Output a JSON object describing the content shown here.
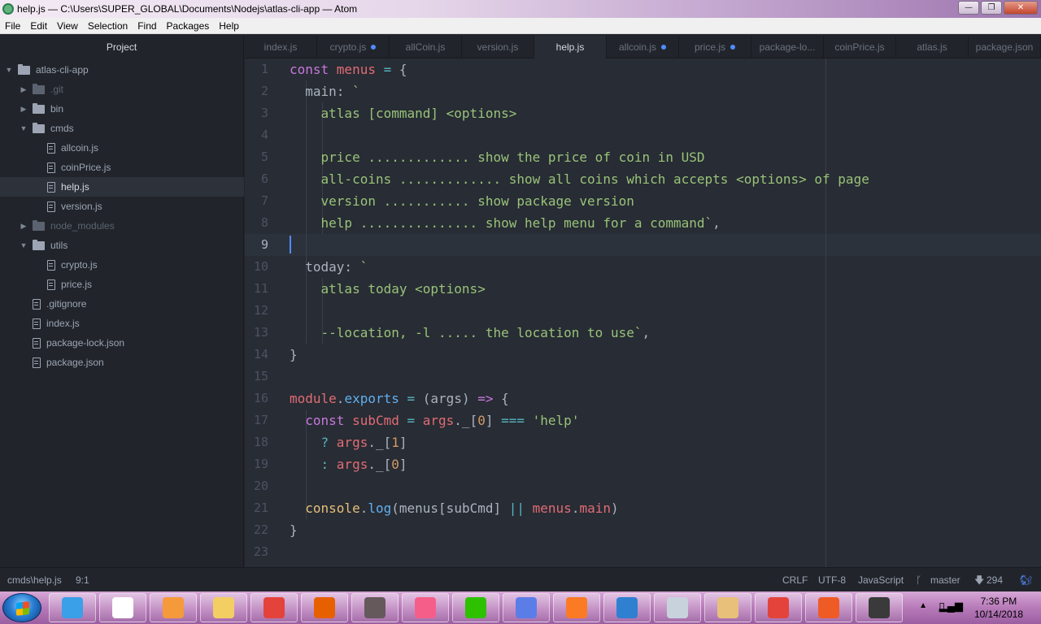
{
  "window": {
    "title": "help.js — C:\\Users\\SUPER_GLOBAL\\Documents\\Nodejs\\atlas-cli-app — Atom"
  },
  "menu": [
    "File",
    "Edit",
    "View",
    "Selection",
    "Find",
    "Packages",
    "Help"
  ],
  "sidebar": {
    "title": "Project",
    "tree": [
      {
        "label": "atlas-cli-app",
        "kind": "folder",
        "level": 0,
        "expanded": true
      },
      {
        "label": ".git",
        "kind": "folder",
        "level": 1,
        "expanded": false,
        "dim": true
      },
      {
        "label": "bin",
        "kind": "folder",
        "level": 1,
        "expanded": false
      },
      {
        "label": "cmds",
        "kind": "folder",
        "level": 1,
        "expanded": true
      },
      {
        "label": "allcoin.js",
        "kind": "file",
        "level": 2
      },
      {
        "label": "coinPrice.js",
        "kind": "file",
        "level": 2
      },
      {
        "label": "help.js",
        "kind": "file",
        "level": 2,
        "selected": true
      },
      {
        "label": "version.js",
        "kind": "file",
        "level": 2
      },
      {
        "label": "node_modules",
        "kind": "folder",
        "level": 1,
        "expanded": false,
        "dim": true
      },
      {
        "label": "utils",
        "kind": "folder",
        "level": 1,
        "expanded": true
      },
      {
        "label": "crypto.js",
        "kind": "file",
        "level": 2
      },
      {
        "label": "price.js",
        "kind": "file",
        "level": 2
      },
      {
        "label": ".gitignore",
        "kind": "file",
        "level": 1
      },
      {
        "label": "index.js",
        "kind": "file",
        "level": 1
      },
      {
        "label": "package-lock.json",
        "kind": "file",
        "level": 1
      },
      {
        "label": "package.json",
        "kind": "file",
        "level": 1
      }
    ]
  },
  "tabs": [
    {
      "label": "index.js",
      "modified": false,
      "active": false
    },
    {
      "label": "crypto.js",
      "modified": true,
      "active": false
    },
    {
      "label": "allCoin.js",
      "modified": false,
      "active": false
    },
    {
      "label": "version.js",
      "modified": false,
      "active": false
    },
    {
      "label": "help.js",
      "modified": false,
      "active": true
    },
    {
      "label": "allcoin.js",
      "modified": true,
      "active": false
    },
    {
      "label": "price.js",
      "modified": true,
      "active": false
    },
    {
      "label": "package-lo...",
      "modified": false,
      "active": false
    },
    {
      "label": "coinPrice.js",
      "modified": false,
      "active": false
    },
    {
      "label": "atlas.js",
      "modified": false,
      "active": false
    },
    {
      "label": "package.json",
      "modified": false,
      "active": false
    }
  ],
  "editor": {
    "current_line": 9,
    "colors": {
      "keyword": "#c678dd",
      "variable": "#e06c75",
      "string": "#98c379",
      "number": "#d19a66",
      "function": "#61afef",
      "operator": "#56b6c2",
      "property": "#e5c07b"
    },
    "lines": [
      [
        [
          "k",
          "const "
        ],
        [
          "v",
          "menus"
        ],
        [
          "c",
          " = "
        ],
        [
          "p",
          "{"
        ]
      ],
      [
        [
          "p",
          "  main: "
        ],
        [
          "s",
          "`"
        ]
      ],
      [
        [
          "s",
          "    atlas [command] <options>"
        ]
      ],
      [
        [
          "s",
          ""
        ]
      ],
      [
        [
          "s",
          "    price ............. show the price of coin in USD"
        ]
      ],
      [
        [
          "s",
          "    all-coins ............. show all coins which accepts <options> of page"
        ]
      ],
      [
        [
          "s",
          "    version ........... show package version"
        ]
      ],
      [
        [
          "s",
          "    help ............... show help menu for a command`"
        ],
        [
          "p",
          ","
        ]
      ],
      [
        [
          "p",
          ""
        ]
      ],
      [
        [
          "p",
          "  today: "
        ],
        [
          "s",
          "`"
        ]
      ],
      [
        [
          "s",
          "    atlas today <options>"
        ]
      ],
      [
        [
          "s",
          ""
        ]
      ],
      [
        [
          "s",
          "    --location, -l ..... the location to use`"
        ],
        [
          "p",
          ","
        ]
      ],
      [
        [
          "p",
          "}"
        ]
      ],
      [
        [
          "p",
          ""
        ]
      ],
      [
        [
          "v",
          "module"
        ],
        [
          "p",
          "."
        ],
        [
          "f",
          "exports"
        ],
        [
          "c",
          " = "
        ],
        [
          "p",
          "(args) "
        ],
        [
          "k",
          "=>"
        ],
        [
          "p",
          " {"
        ]
      ],
      [
        [
          "k",
          "  const "
        ],
        [
          "v",
          "subCmd"
        ],
        [
          "c",
          " = "
        ],
        [
          "v",
          "args"
        ],
        [
          "p",
          "._["
        ],
        [
          "n",
          "0"
        ],
        [
          "p",
          "] "
        ],
        [
          "c",
          "==="
        ],
        [
          "s",
          " 'help'"
        ]
      ],
      [
        [
          "c",
          "    ? "
        ],
        [
          "v",
          "args"
        ],
        [
          "p",
          "._["
        ],
        [
          "n",
          "1"
        ],
        [
          "p",
          "]"
        ]
      ],
      [
        [
          "c",
          "    : "
        ],
        [
          "v",
          "args"
        ],
        [
          "p",
          "._["
        ],
        [
          "n",
          "0"
        ],
        [
          "p",
          "]"
        ]
      ],
      [
        [
          "p",
          ""
        ]
      ],
      [
        [
          "y",
          "  console"
        ],
        [
          "p",
          "."
        ],
        [
          "f",
          "log"
        ],
        [
          "p",
          "(menus[subCmd] "
        ],
        [
          "c",
          "||"
        ],
        [
          "v",
          " menus"
        ],
        [
          "p",
          "."
        ],
        [
          "v",
          "main"
        ],
        [
          "p",
          ")"
        ]
      ],
      [
        [
          "p",
          "}"
        ]
      ],
      [
        [
          "p",
          ""
        ]
      ]
    ]
  },
  "status": {
    "path": "cmds\\help.js",
    "cursor": "9:1",
    "line_ending": "CRLF",
    "encoding": "UTF-8",
    "grammar": "JavaScript",
    "branch": "master",
    "behind": "294"
  },
  "taskbar": {
    "time": "7:36 PM",
    "date": "10/14/2018",
    "apps": [
      {
        "name": "internet-explorer",
        "color": "#3aa0e8"
      },
      {
        "name": "notepad",
        "color": "#ffffff"
      },
      {
        "name": "media-player",
        "color": "#f59a3a"
      },
      {
        "name": "file-explorer",
        "color": "#f3cf63"
      },
      {
        "name": "chrome",
        "color": "#e4433b"
      },
      {
        "name": "firefox",
        "color": "#e66000"
      },
      {
        "name": "atom",
        "color": "#66595c"
      },
      {
        "name": "itunes",
        "color": "#f65e8a"
      },
      {
        "name": "wechat",
        "color": "#2dc100"
      },
      {
        "name": "git-extension",
        "color": "#5b7de8"
      },
      {
        "name": "xampp",
        "color": "#fb7a24"
      },
      {
        "name": "vscode",
        "color": "#2f80d1"
      },
      {
        "name": "calculator",
        "color": "#c8d2dc"
      },
      {
        "name": "paint",
        "color": "#e8c07a"
      },
      {
        "name": "chrome-2",
        "color": "#e4433b"
      },
      {
        "name": "postman",
        "color": "#ef5b25"
      },
      {
        "name": "video-editor",
        "color": "#3a3a3a"
      }
    ]
  }
}
